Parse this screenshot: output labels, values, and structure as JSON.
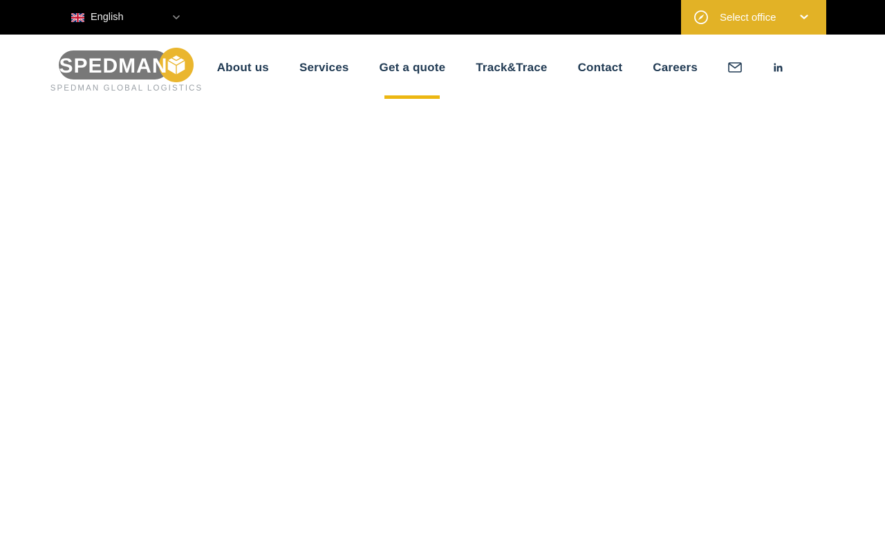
{
  "topbar": {
    "language": {
      "label": "English",
      "flag_icon": "uk-flag-icon",
      "chevron_icon": "chevron-down-icon"
    },
    "select_office": {
      "label": "Select office",
      "icon": "compass-icon",
      "chevron_icon": "chevron-down-icon"
    }
  },
  "header": {
    "logo": {
      "wordmark": "SPEDMAN",
      "tagline": "SPEDMAN GLOBAL LOGISTICS",
      "cube_icon": "cube-icon"
    },
    "nav": {
      "items": [
        {
          "label": "About us",
          "active": false
        },
        {
          "label": "Services",
          "active": false
        },
        {
          "label": "Get a quote",
          "active": true
        },
        {
          "label": "Track&Trace",
          "active": false
        },
        {
          "label": "Contact",
          "active": false
        },
        {
          "label": "Careers",
          "active": false
        }
      ]
    },
    "action_icons": [
      {
        "name": "email-icon"
      },
      {
        "name": "linkedin-icon"
      }
    ]
  },
  "colors": {
    "topbar_bg": "#000000",
    "accent_yellow": "#e2b226",
    "underline_yellow": "#ecb713",
    "logo_circle_yellow": "#eab62e",
    "nav_text": "#203a53",
    "logo_grey": "#787878",
    "tagline_grey": "#9aa0a6",
    "topbar_text": "#efefef"
  },
  "main": {
    "content": ""
  }
}
